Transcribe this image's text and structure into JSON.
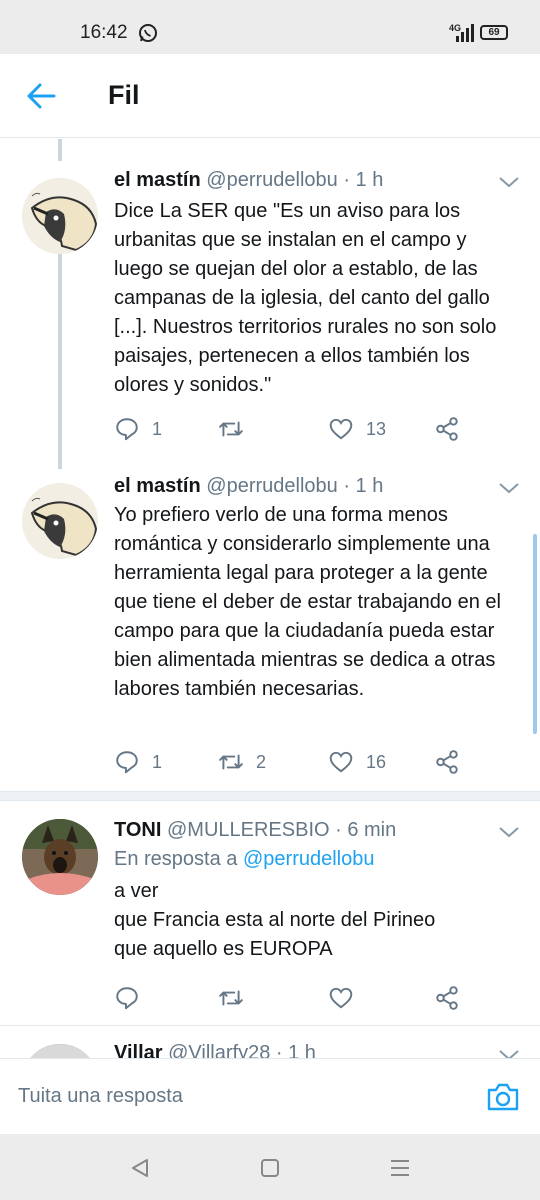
{
  "status_bar": {
    "time": "16:42",
    "network": "4G",
    "battery": "69"
  },
  "header": {
    "title": "Fil"
  },
  "tweets": [
    {
      "name": "el mastín",
      "handle": "@perrudellobu",
      "time": "· 1 h",
      "text": "Dice La SER que \"Es un aviso para los urbanitas que se instalan en el campo y luego se quejan del olor a establo, de las campanas de la iglesia, del canto del gallo [...]. Nuestros territorios rurales no son solo paisajes, pertenecen a ellos también los olores y sonidos.\"",
      "replies": "1",
      "retweets": "",
      "likes": "13"
    },
    {
      "name": "el mastín",
      "handle": "@perrudellobu",
      "time": "· 1 h",
      "text": "Yo prefiero verlo de una forma menos romántica y considerarlo simplemente una herramienta legal para proteger a la gente que tiene el deber de estar trabajando en el campo para que la ciudadanía pueda estar bien alimentada mientras se dedica a otras labores también necesarias.",
      "replies": "1",
      "retweets": "2",
      "likes": "16"
    },
    {
      "name": "TONI",
      "handle": "@MULLERESBIO",
      "time": "· 6 min",
      "reply_prefix": "En resposta a",
      "reply_user": "@perrudellobu",
      "text": "a ver\nque Francia esta al norte del Pirineo\nque aquello es EUROPA",
      "replies": "",
      "retweets": "",
      "likes": ""
    },
    {
      "name": "Villar",
      "handle": "@Villarfy28",
      "time": "· 1 h"
    }
  ],
  "compose": {
    "placeholder": "Tuita una resposta"
  },
  "colors": {
    "accent": "#1da1f2",
    "secondary_text": "#657786",
    "divider": "#e1e8ed"
  }
}
